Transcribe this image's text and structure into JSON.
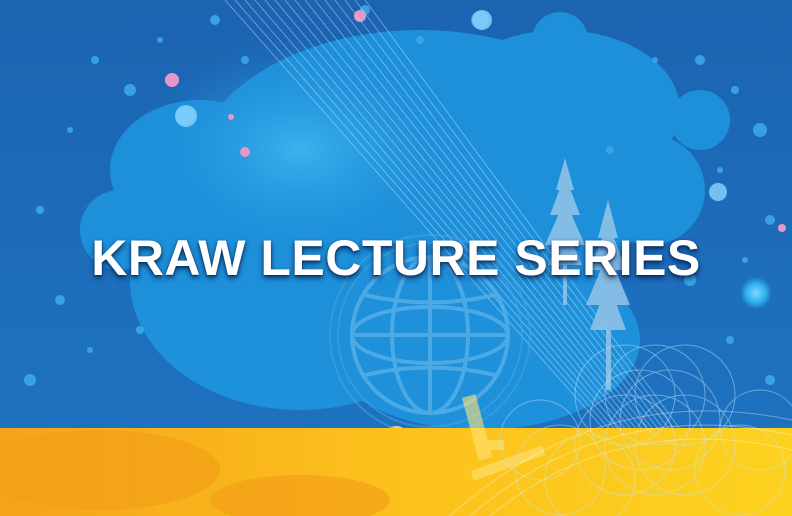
{
  "banner": {
    "title": "KRAW LECTURE SERIES"
  },
  "icons": [
    "globe-icon",
    "redwood-tree-icon",
    "redwood-tree-icon",
    "microscope-icon",
    "paint-splatter-graphic",
    "spirograph-pattern"
  ],
  "colors": {
    "background_blue": "#1c63b0",
    "splatter_blue": "#1e9be3",
    "bottom_band_yellow": "#fbc21a",
    "bottom_band_orange": "#f6a417",
    "title_text": "#ffffff",
    "accent_pink": "#e695c7"
  }
}
